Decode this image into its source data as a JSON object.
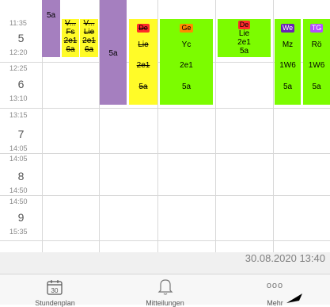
{
  "periods": [
    {
      "start": "11:35",
      "num": "5",
      "end": "12:20"
    },
    {
      "start": "12:25",
      "num": "6",
      "end": "13:10"
    },
    {
      "start": "13:15",
      "num": "7",
      "end": "14:05"
    },
    {
      "start": "14:05",
      "num": "8",
      "end": "14:50"
    },
    {
      "start": "14:50",
      "num": "9",
      "end": "15:35"
    }
  ],
  "lessons": {
    "col1_class": "5a",
    "col2": {
      "subject": "V...",
      "teacher": "Fs",
      "room": "2e1",
      "class": "6a"
    },
    "col3": {
      "subject": "V...",
      "teacher": "Lie",
      "room": "2e1",
      "class": "6a"
    },
    "col4_class": "5a",
    "col5": {
      "subject": "De",
      "teacher": "Lie",
      "room": "2e1",
      "class": "5a"
    },
    "col6": {
      "subject": "Ge",
      "teacher": "Yc",
      "room": "2e1",
      "class": "5a"
    },
    "col7": {
      "subject": "De",
      "teacher": "Lie",
      "room": "2e1",
      "class": "5a"
    },
    "col8": {
      "subject": "We",
      "teacher": "Mz",
      "room": "1W6",
      "class": "5a"
    },
    "col9": {
      "subject": "TG",
      "teacher": "Rö",
      "room": "1W6",
      "class": "5a"
    }
  },
  "colors": {
    "red_tag": "#ff2a2a",
    "orange_tag": "#ff8c00",
    "purple_tag": "#6a1fb5",
    "violet_tag": "#b44dff"
  },
  "footer": {
    "timestamp": "30.08.2020 13:40"
  },
  "tabs": [
    {
      "label": "Stundenplan",
      "icon": "calendar-icon",
      "date": "30"
    },
    {
      "label": "Mitteilungen",
      "icon": "bell-icon"
    },
    {
      "label": "Mehr",
      "icon": "more-dots-icon",
      "glyph": "ooo"
    }
  ]
}
